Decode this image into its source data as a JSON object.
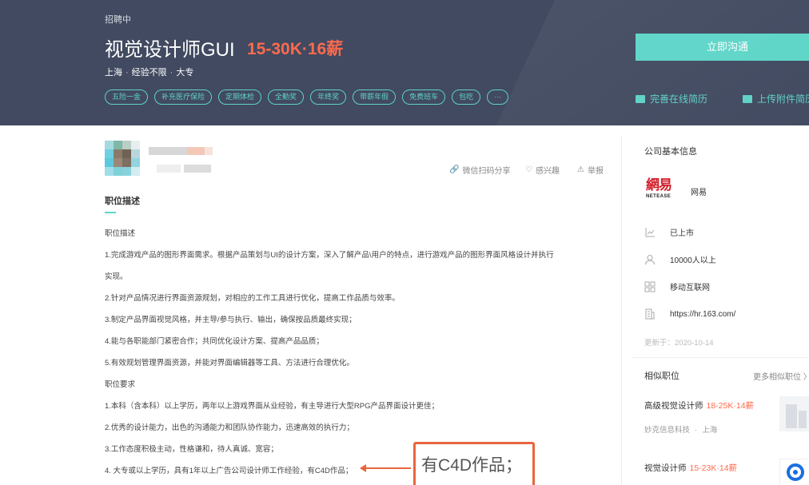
{
  "header": {
    "status": "招聘中",
    "title": "视觉设计师GUI",
    "salary": "15-30K·16薪",
    "location": "上海",
    "experience": "经验不限",
    "education": "大专",
    "tags": [
      "五险一金",
      "补充医疗保险",
      "定期体检",
      "全勤奖",
      "年终奖",
      "带薪年假",
      "免费班车",
      "包吃",
      "···"
    ],
    "chat_button": "立即沟通",
    "online_resume": "完善在线简历",
    "upload_resume": "上传附件简历"
  },
  "actions": {
    "wechat_share": "微信扫码分享",
    "interested": "感兴趣",
    "report": "举报"
  },
  "description": {
    "section_title": "职位描述",
    "lines": [
      "职位描述",
      "1.完成游戏产品的图形界面需求。根据产品策划与UI的设计方案，深入了解产品\\用户的特点，进行游戏产品的图形界面风格设计并执行",
      "实现。",
      "2.针对产品情况进行界面资源规划，对相应的工作工具进行优化，提高工作品质与效率。",
      "3.制定产品界面视觉风格，并主导/参与执行、输出，确保按品质最终实现；",
      "4.能与各职能部门紧密合作；共同优化设计方案、提高产品品质；",
      "5.有效规划管理界面资源，并能对界面编辑器等工具、方法进行合理优化。",
      "职位要求",
      "1.本科（含本科）以上学历，两年以上游戏界面从业经验，有主导进行大型RPG产品界面设计更佳；",
      "2.优秀的设计能力，出色的沟通能力和团队协作能力，迅速高效的执行力；",
      "3.工作态度积极主动，性格谦和，待人真诚、宽容；",
      "4. 大专或以上学历，具有1年以上广告公司设计师工作经验，有C4D作品；"
    ],
    "callout": "有C4D作品；"
  },
  "company": {
    "section_title": "公司基本信息",
    "logo_cn": "網易",
    "logo_en": "NETEASE",
    "name": "网易",
    "listing": "已上市",
    "size": "10000人以上",
    "industry": "移动互联网",
    "website": "https://hr.163.com/",
    "updated": "更新于：2020-10-14"
  },
  "similar": {
    "section_title": "相似职位",
    "more": "更多相似职位 〉",
    "jobs": [
      {
        "title": "高级视觉设计师",
        "salary": "18-25K·14薪",
        "company": "妙克信息科技",
        "city": "上海"
      },
      {
        "title": "视觉设计师",
        "salary": "15-23K·14薪"
      }
    ]
  },
  "colors": {
    "banner": "#414a60",
    "accent": "#5dd5c8",
    "salary": "#ff6a4d",
    "callout": "#e8663d"
  }
}
